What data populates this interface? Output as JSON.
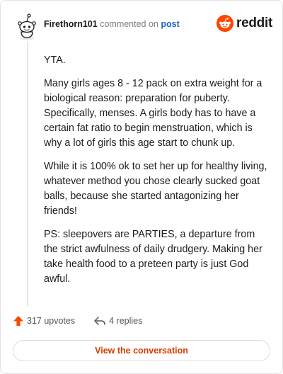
{
  "header": {
    "username": "Firethorn101",
    "action_text": "commented on",
    "post_link": "post",
    "brand": "reddit"
  },
  "comment": {
    "paragraphs": [
      "YTA.",
      "Many girls ages 8 - 12 pack on extra weight for a biological reason: preparation for puberty. Specifically, menses. A girls body has to have a certain fat ratio to begin menstruation, which is why a lot of girls this age start to chunk up.",
      "While it is 100% ok to set her up for healthy living, whatever method you chose clearly sucked goat balls, because she started antagonizing her friends!",
      "PS: sleepovers are PARTIES, a departure from the strict awfulness of daily drudgery. Making her take health food to a preteen party is just God awful."
    ]
  },
  "actions": {
    "upvotes": "317 upvotes",
    "replies": "4 replies"
  },
  "cta": {
    "label": "View the conversation"
  },
  "icons": {
    "avatar": "snoo-avatar-icon",
    "brand_logo": "reddit-logo-icon",
    "upvote": "upvote-arrow-icon",
    "reply": "reply-arrow-icon"
  },
  "colors": {
    "brand": "#ff4500",
    "upvote": "#ff4500",
    "link": "#1a65c8",
    "cta_text": "#d93a00"
  }
}
